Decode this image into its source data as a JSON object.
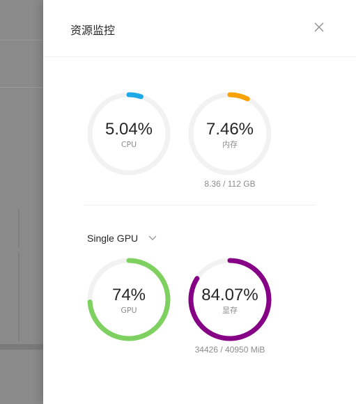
{
  "drawer": {
    "title": "资源监控"
  },
  "gauges": {
    "cpu": {
      "value_text": "5.04%",
      "label": "CPU",
      "percent": 5.04,
      "color": "#1fa9e8"
    },
    "memory": {
      "value_text": "7.46%",
      "label": "内存",
      "percent": 7.46,
      "color": "#f7a200",
      "detail": "8.36 / 112 GB"
    },
    "gpu": {
      "value_text": "74%",
      "label": "GPU",
      "percent": 74,
      "color": "#7ed160"
    },
    "vram": {
      "value_text": "84.07%",
      "label": "显存",
      "percent": 84.07,
      "color": "#850085",
      "detail": "34426 / 40950 MiB"
    }
  },
  "gpu_selector": {
    "selected": "Single GPU"
  },
  "colors": {
    "track": "#f2f2f2"
  }
}
